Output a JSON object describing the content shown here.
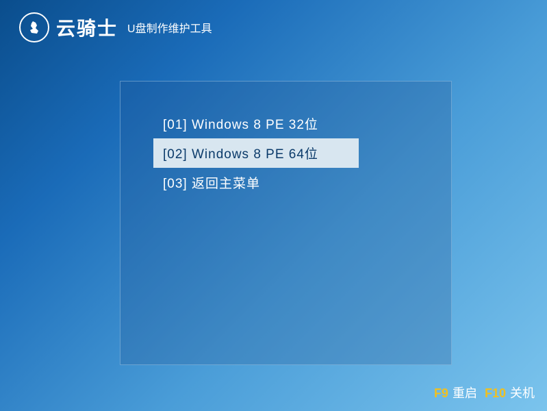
{
  "header": {
    "brand": "云骑士",
    "subtitle": "U盘制作维护工具"
  },
  "menu": {
    "items": [
      {
        "label": "[01] Windows 8 PE 32位",
        "selected": false
      },
      {
        "label": "[02] Windows 8 PE 64位",
        "selected": true
      },
      {
        "label": "[03] 返回主菜单",
        "selected": false
      }
    ]
  },
  "footer": {
    "f9_key": "F9",
    "f9_label": "重启",
    "f10_key": "F10",
    "f10_label": "关机"
  }
}
